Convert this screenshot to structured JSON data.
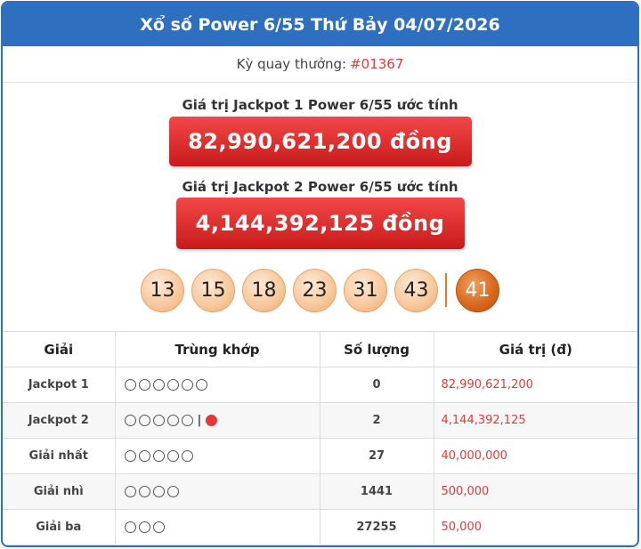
{
  "header": {
    "title": "Xổ số Power 6/55 Thứ Bảy 04/07/2026"
  },
  "draw": {
    "label": "Kỳ quay thưởng:",
    "code": "#01367"
  },
  "jackpot1": {
    "label": "Giá trị Jackpot 1 Power 6/55 ước tính",
    "value": "82,990,621,200 đồng"
  },
  "jackpot2": {
    "label": "Giá trị Jackpot 2 Power 6/55 ước tính",
    "value": "4,144,392,125 đồng"
  },
  "results": {
    "numbers": [
      "13",
      "15",
      "18",
      "23",
      "31",
      "43"
    ],
    "special": "41"
  },
  "table": {
    "headers": [
      "Giải",
      "Trùng khớp",
      "Số lượng",
      "Giá trị (đ)"
    ],
    "rows": [
      {
        "name": "Jackpot 1",
        "match_count": 6,
        "special": false,
        "qty": "0",
        "value": "82,990,621,200"
      },
      {
        "name": "Jackpot 2",
        "match_count": 5,
        "special": true,
        "qty": "2",
        "value": "4,144,392,125"
      },
      {
        "name": "Giải nhất",
        "match_count": 5,
        "special": false,
        "qty": "27",
        "value": "40,000,000"
      },
      {
        "name": "Giải nhì",
        "match_count": 4,
        "special": false,
        "qty": "1441",
        "value": "500,000"
      },
      {
        "name": "Giải ba",
        "match_count": 3,
        "special": false,
        "qty": "27255",
        "value": "50,000"
      }
    ],
    "special_separator": "|"
  },
  "colors": {
    "brand": "#2f6fbf",
    "accent_red": "#e53935",
    "ball": "#f7c79a",
    "special_ball": "#d8651b"
  }
}
